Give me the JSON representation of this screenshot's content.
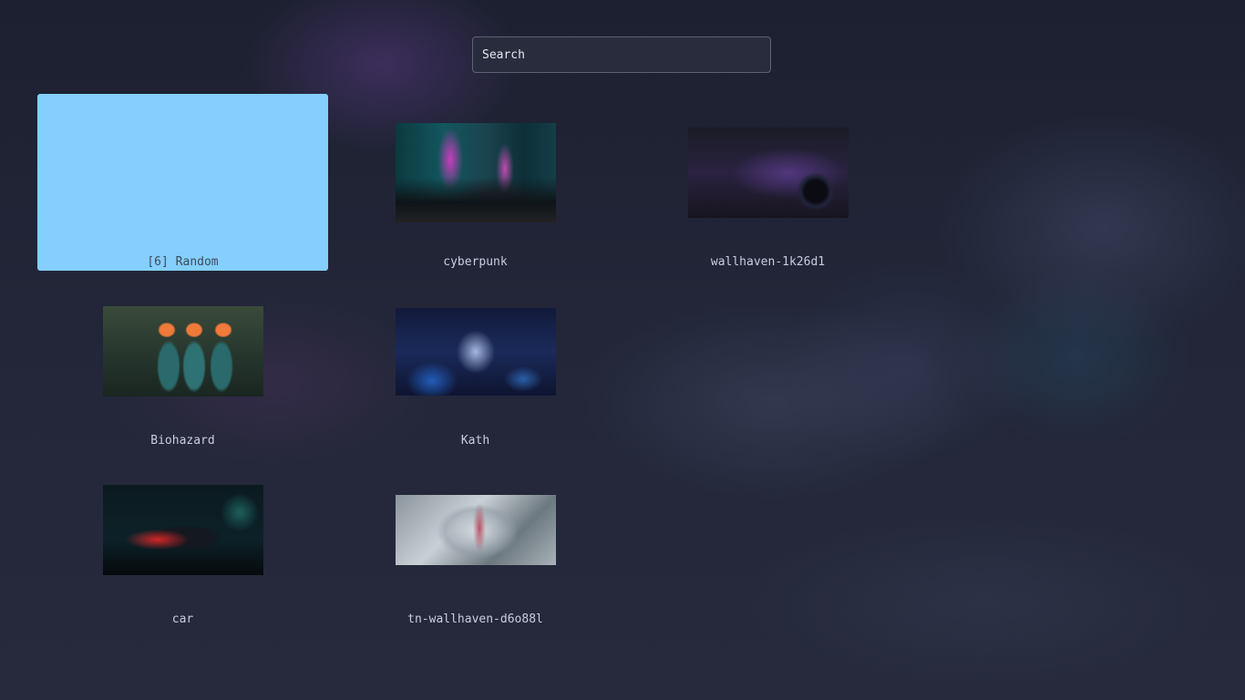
{
  "search": {
    "placeholder": "Search",
    "value": ""
  },
  "selected_index": 0,
  "items": [
    {
      "label": "[6] Random",
      "thumbnail": "",
      "selected": true
    },
    {
      "label": "cyberpunk",
      "thumbnail": "neon city street with car"
    },
    {
      "label": "wallhaven-1k26d1",
      "thumbnail": "purple sports car rear"
    },
    {
      "label": "Biohazard",
      "thumbnail": "hooded figures with biohazard signs"
    },
    {
      "label": "Kath",
      "thumbnail": "anime girl with laptop in blue light"
    },
    {
      "label": "car",
      "thumbnail": "sports car with red light trails at night"
    },
    {
      "label": "tn-wallhaven-d6o88l",
      "thumbnail": "anime figure inside clockwork"
    }
  ],
  "colors": {
    "selection": "#84cffd",
    "label_text": "#c9cde0",
    "background": "#222638"
  }
}
